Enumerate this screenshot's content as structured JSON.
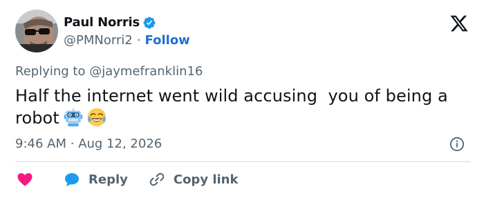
{
  "author": {
    "display_name": "Paul Norris",
    "handle": "@PMNorri2",
    "separator": "·",
    "follow_label": "Follow"
  },
  "reply_context": {
    "prefix": "Replying to",
    "mention": "@jaymefranklin16"
  },
  "tweet": {
    "text": "Half the internet went wild accusing  you of being a robot",
    "emojis": [
      "robot-face-emoji",
      "tears-of-joy-emoji"
    ]
  },
  "timestamp": {
    "time": "9:46 AM",
    "separator": "·",
    "date": "Aug 12, 2026"
  },
  "actions": {
    "reply_label": "Reply",
    "copy_label": "Copy link"
  },
  "colors": {
    "link_blue": "#1d6ed8",
    "verified_blue": "#1d9bf0",
    "like_pink": "#f91880",
    "muted_text": "#536471"
  }
}
